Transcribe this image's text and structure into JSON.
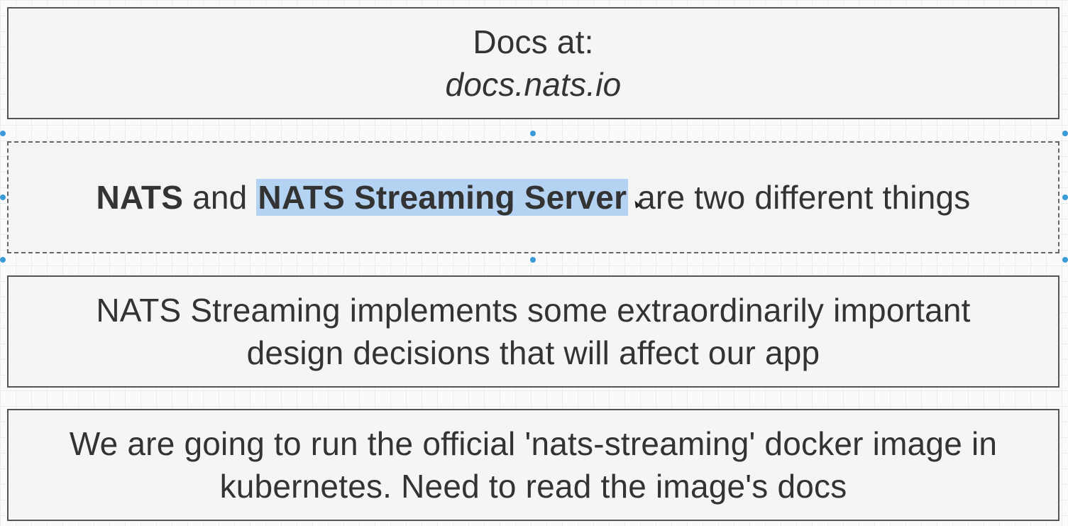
{
  "boxes": [
    {
      "line1": "Docs at:",
      "line2": "docs.nats.io"
    },
    {
      "part1": "NATS",
      "part2": " and ",
      "part3": "NATS Streaming Server",
      "part4": " are two different things"
    },
    {
      "line1": "NATS Streaming implements some extraordinarily important",
      "line2": "design decisions that will affect our app"
    },
    {
      "line1": "We are going to run the official 'nats-streaming' docker image in",
      "line2": "kubernetes.  Need to read the image's docs"
    }
  ],
  "colors": {
    "selection_handle": "#3a9ad9",
    "text_highlight": "#b4d3f3",
    "box_fill": "#f5f5f5",
    "box_border": "#555555"
  }
}
